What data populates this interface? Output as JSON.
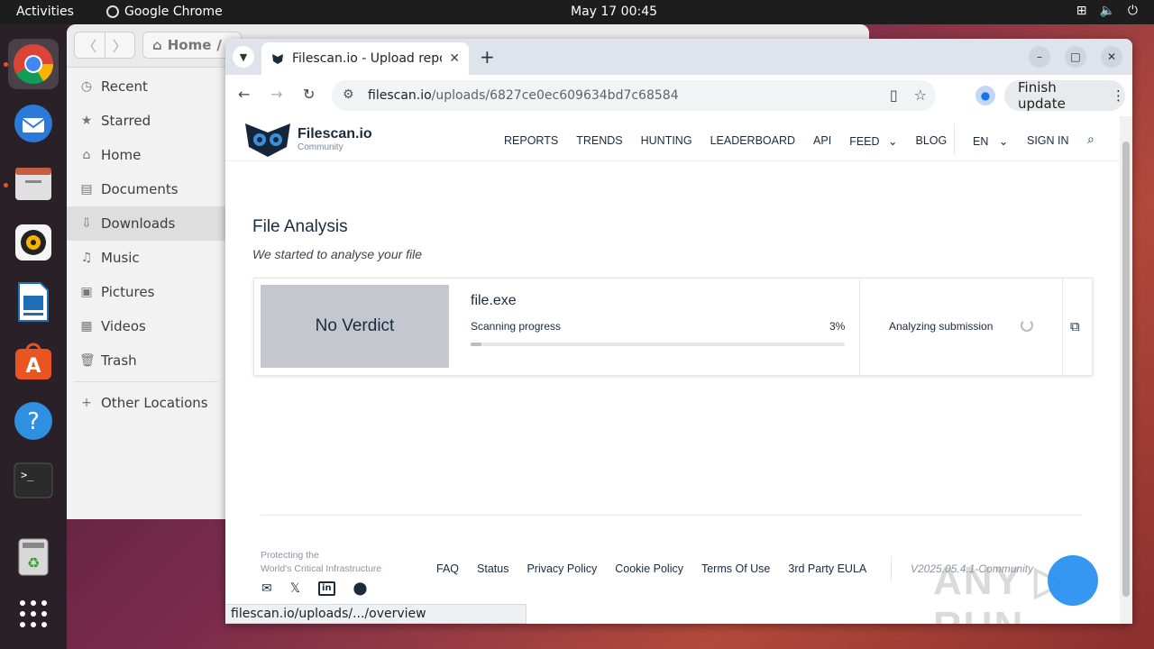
{
  "topbar": {
    "activities": "Activities",
    "app_name": "Google Chrome",
    "clock": "May 17  00:45"
  },
  "dock": {
    "items": [
      "chrome-icon",
      "thunderbird-icon",
      "files-icon",
      "rhythmbox-icon",
      "writer-icon",
      "app-center-icon",
      "help-icon",
      "terminal-icon",
      "trash-icon",
      "apps-grid-icon"
    ]
  },
  "files": {
    "path_label": "Home",
    "sidebar": [
      {
        "label": "Recent",
        "icon": "clock-icon"
      },
      {
        "label": "Starred",
        "icon": "star-icon"
      },
      {
        "label": "Home",
        "icon": "home-icon"
      },
      {
        "label": "Documents",
        "icon": "document-icon"
      },
      {
        "label": "Downloads",
        "icon": "download-icon"
      },
      {
        "label": "Music",
        "icon": "music-icon"
      },
      {
        "label": "Pictures",
        "icon": "picture-icon"
      },
      {
        "label": "Videos",
        "icon": "video-icon"
      },
      {
        "label": "Trash",
        "icon": "trash-icon"
      },
      {
        "label": "Other Locations",
        "icon": "plus-icon"
      }
    ]
  },
  "chrome": {
    "tab_title": "Filescan.io - Upload repo",
    "url_domain": "filescan.io",
    "url_path": "/uploads/6827ce0ec609634bd7c68584",
    "finish_update": "Finish update",
    "status_url": "filescan.io/uploads/.../overview"
  },
  "site": {
    "logo_name": "Filescan.io",
    "logo_sub": "Community",
    "menu": [
      "REPORTS",
      "TRENDS",
      "HUNTING",
      "LEADERBOARD",
      "API",
      "FEED",
      "BLOG"
    ],
    "lang": "EN",
    "signin": "SIGN IN",
    "title": "File Analysis",
    "subtitle": "We started to analyse your file",
    "verdict": "No Verdict",
    "file_name": "file.exe",
    "progress_label": "Scanning progress",
    "progress_pct": "3%",
    "progress_value": 0.03,
    "analyzing": "Analyzing submission",
    "protect_line1": "Protecting the",
    "protect_line2": "World's Critical Infrastructure",
    "footer_links": [
      "FAQ",
      "Status",
      "Privacy Policy",
      "Cookie Policy",
      "Terms Of Use",
      "3rd Party EULA"
    ],
    "version": "V2025.05.4.1-Community"
  }
}
